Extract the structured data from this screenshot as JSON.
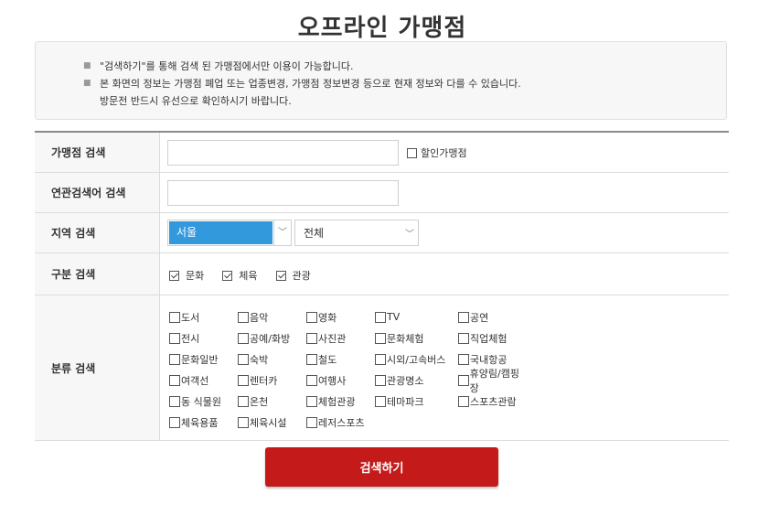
{
  "page": {
    "title": "오프라인 가맹점"
  },
  "notice": {
    "lines": [
      "\"검색하기\"를 통해 검색 된 가맹점에서만 이용이 가능합니다.",
      "본 화면의 정보는 가맹점 폐업 또는 업종변경, 가맹점 정보변경 등으로 현재 정보와 다를 수 있습니다.",
      "방문전 반드시 유선으로 확인하시기 바랍니다."
    ],
    "bullet": "■"
  },
  "form": {
    "store_search": {
      "label": "가맹점 검색",
      "value": "",
      "discount_label": "할인가맹점",
      "discount_checked": false
    },
    "keyword_search": {
      "label": "연관검색어 검색",
      "value": ""
    },
    "region_search": {
      "label": "지역 검색",
      "city": "서울",
      "district": "전체"
    },
    "type_search": {
      "label": "구분 검색",
      "options": [
        {
          "label": "문화",
          "checked": true
        },
        {
          "label": "체육",
          "checked": true
        },
        {
          "label": "관광",
          "checked": true
        }
      ]
    },
    "category_search": {
      "label": "분류 검색",
      "rows": [
        [
          "도서",
          "음악",
          "영화",
          "TV",
          "공연"
        ],
        [
          "전시",
          "공예/화방",
          "사진관",
          "문화체험",
          "직업체험"
        ],
        [
          "문화일반",
          "숙박",
          "철도",
          "시외/고속버스",
          "국내항공"
        ],
        [
          "여객선",
          "렌터카",
          "여행사",
          "관광명소",
          "휴양림/캠핑장"
        ],
        [
          "동 식물원",
          "온천",
          "체험관광",
          "테마파크",
          "스포츠관람"
        ],
        [
          "체육용품",
          "체육시설",
          "레저스포츠"
        ]
      ]
    }
  },
  "submit": {
    "label": "검색하기"
  },
  "colors": {
    "accent": "#c41a1a",
    "select_highlight": "#3399dd"
  }
}
